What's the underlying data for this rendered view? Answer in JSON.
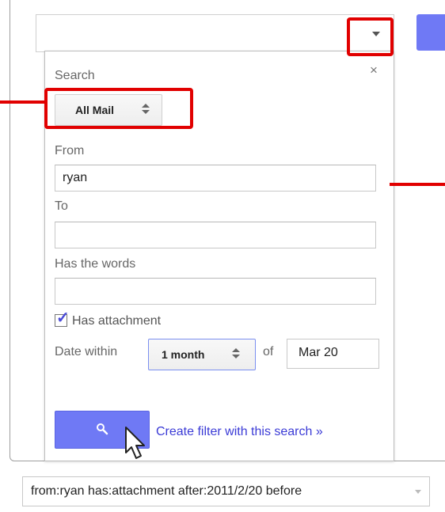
{
  "search_panel": {
    "search_label": "Search",
    "close_glyph": "×",
    "scope_select": {
      "selected": "All Mail"
    },
    "from": {
      "label": "From",
      "value": "ryan"
    },
    "to": {
      "label": "To",
      "value": ""
    },
    "has_words": {
      "label": "Has the words",
      "value": ""
    },
    "attachment": {
      "label": "Has attachment",
      "checked": true
    },
    "date_within": {
      "label": "Date within",
      "range": "1 month",
      "of_label": "of",
      "date": "Mar 20"
    },
    "create_filter_link": "Create filter with this search »"
  },
  "query_bar": {
    "value": "from:ryan has:attachment after:2011/2/20 before"
  },
  "icons": {
    "dropdown": "chevron-down-icon",
    "close": "close-icon",
    "search": "search-icon",
    "cursor": "mouse-pointer-icon",
    "check": "checkmark-icon"
  },
  "colors": {
    "accent_blue": "#6f79f5",
    "highlight_red": "#e10000",
    "link_blue": "#3b3bd6",
    "check_blue": "#4b4bd8"
  }
}
